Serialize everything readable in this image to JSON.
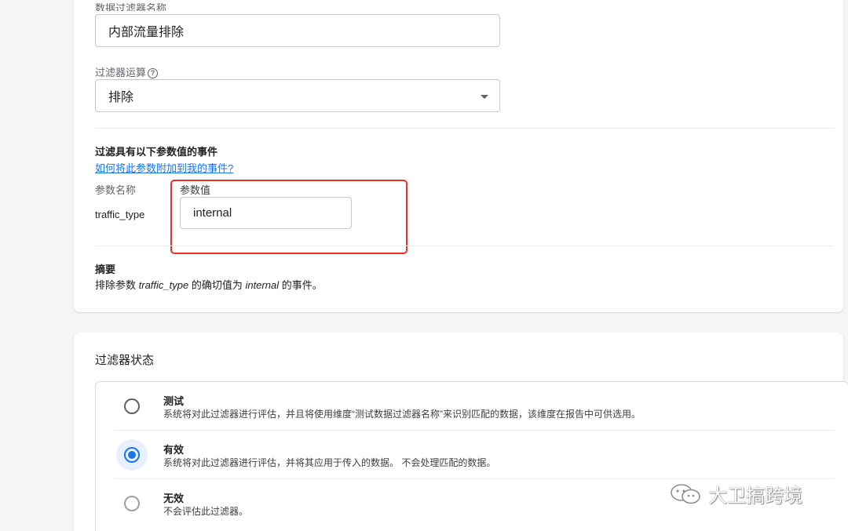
{
  "filter_form": {
    "name_label": "数据过滤器名称",
    "name_value": "内部流量排除",
    "operation_label": "过滤器运算",
    "operation_help_icon": "help-circle-icon",
    "operation_value": "排除",
    "dropdown_icon": "caret-down-icon",
    "param_section_title": "过滤具有以下参数值的事件",
    "param_help_link": "如何将此参数附加到我的事件?",
    "param_name_header": "参数名称",
    "param_value_header": "参数值",
    "param_name": "traffic_type",
    "param_value": "internal",
    "summary_title": "摘要",
    "summary_prefix": "排除参数 ",
    "summary_param": "traffic_type",
    "summary_middle": " 的确切值为 ",
    "summary_value": "internal",
    "summary_suffix": " 的事件。"
  },
  "filter_status": {
    "title": "过滤器状态",
    "options": [
      {
        "title": "测试",
        "desc": "系统将对此过滤器进行评估，并且将使用维度“测试数据过滤器名称”来识别匹配的数据，该维度在报告中可供选用。",
        "selected": false
      },
      {
        "title": "有效",
        "desc": "系统将对此过滤器进行评估，并将其应用于传入的数据。 不会处理匹配的数据。",
        "selected": true
      },
      {
        "title": "无效",
        "desc": "不会评估此过滤器。",
        "selected": false
      }
    ]
  },
  "watermark": {
    "icon": "wechat-icon",
    "text": "大卫搞跨境"
  },
  "colors": {
    "accent": "#1a73e8",
    "highlight_box": "#e5332a"
  }
}
